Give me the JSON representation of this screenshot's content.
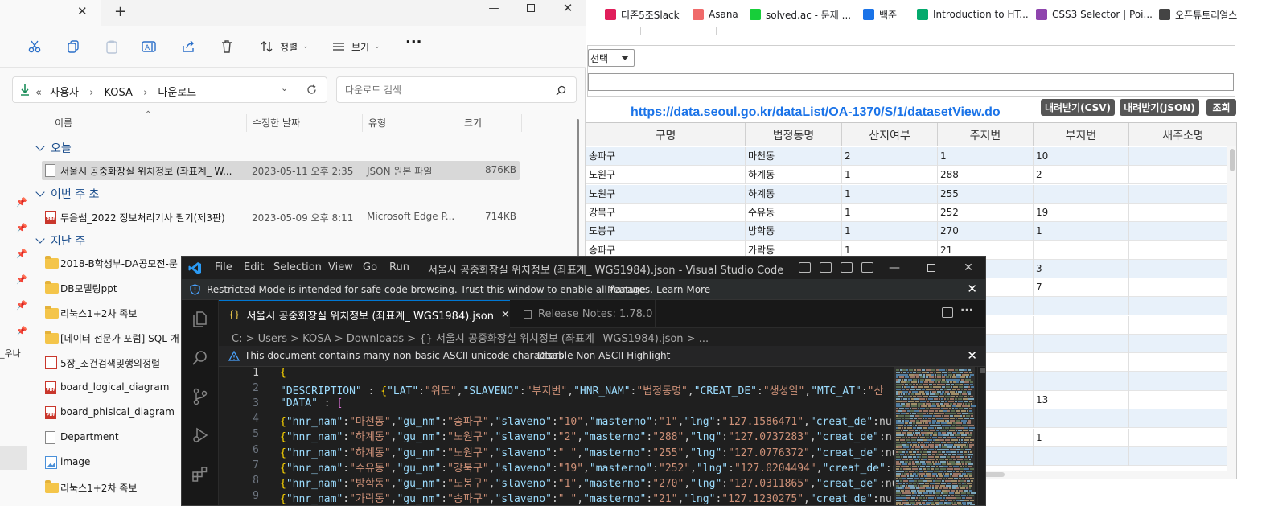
{
  "bookmarks": [
    {
      "label": "더존5조Slack",
      "icon": "slack-icon",
      "color": "#e01e5a"
    },
    {
      "label": "Asana",
      "icon": "asana-icon",
      "color": "#f06a6a"
    },
    {
      "label": "solved.ac - 문제 ...",
      "icon": "solvedac-icon",
      "color": "#17ce3a"
    },
    {
      "label": "백준",
      "icon": "code-icon",
      "color": "#1a73e8"
    },
    {
      "label": "Introduction to HT...",
      "icon": "w3schools-icon",
      "color": "#04aa6d"
    },
    {
      "label": "CSS3 Selector | Poi...",
      "icon": "css-icon",
      "color": "#8e44ad"
    },
    {
      "label": "오픈튜토리얼스",
      "icon": "globe-icon",
      "color": "#444444"
    }
  ],
  "seoul": {
    "select_label": "선택",
    "dataset_url": "https://data.seoul.go.kr/dataList/OA-1370/S/1/datasetView.do",
    "btn_csv": "내려받기(CSV)",
    "btn_json": "내려받기(JSON)",
    "btn_query": "조회",
    "columns": [
      "구명",
      "법정동명",
      "산지여부",
      "주지번",
      "부지번",
      "새주소명"
    ],
    "rows": [
      [
        "송파구",
        "마천동",
        "2",
        "1",
        "10",
        ""
      ],
      [
        "노원구",
        "하계동",
        "1",
        "288",
        "2",
        ""
      ],
      [
        "노원구",
        "하계동",
        "1",
        "255",
        "",
        ""
      ],
      [
        "강북구",
        "수유동",
        "1",
        "252",
        "19",
        ""
      ],
      [
        "도봉구",
        "방학동",
        "1",
        "270",
        "1",
        ""
      ],
      [
        "송파구",
        "가락동",
        "1",
        "21",
        "",
        ""
      ],
      [
        "",
        "",
        "",
        "",
        "3",
        ""
      ],
      [
        "",
        "",
        "",
        "",
        "7",
        ""
      ],
      [
        "",
        "",
        "",
        "",
        "",
        ""
      ],
      [
        "",
        "",
        "",
        "",
        "",
        ""
      ],
      [
        "",
        "",
        "",
        "",
        "",
        ""
      ],
      [
        "",
        "",
        "",
        "",
        "",
        ""
      ],
      [
        "",
        "",
        "",
        "",
        "",
        ""
      ],
      [
        "",
        "",
        "",
        "",
        "13",
        ""
      ],
      [
        "",
        "",
        "",
        "",
        "",
        ""
      ],
      [
        "",
        "",
        "",
        "",
        "1",
        ""
      ],
      [
        "",
        "",
        "",
        "",
        "",
        ""
      ]
    ]
  },
  "explorer": {
    "toolbar": {
      "sort": "정렬",
      "view": "보기"
    },
    "breadcrumb": [
      "사용자",
      "KOSA",
      "다운로드"
    ],
    "search_placeholder": "다운로드 검색",
    "columns": {
      "name": "이름",
      "date": "수정한 날짜",
      "type": "유형",
      "size": "크기"
    },
    "groups": {
      "today": "오늘",
      "this_week": "이번 주 초",
      "last_week": "지난 주"
    },
    "files_today": [
      {
        "name": "서울시 공중화장실 위치정보 (좌표계_ W...",
        "date": "2023-05-11 오후 2:35",
        "type": "JSON 원본 파일",
        "size": "876KB"
      }
    ],
    "files_week": [
      {
        "name": "두음쌤_2022 정보처리기사 필기(제3판)",
        "date": "2023-05-09 오후 8:11",
        "type": "Microsoft Edge P...",
        "size": "714KB"
      }
    ],
    "files_last": [
      {
        "name": "2018-B학생부-DA공모전-문",
        "kind": "folder"
      },
      {
        "name": "DB모델링ppt",
        "kind": "folder"
      },
      {
        "name": "리눅스1+2차 족보",
        "kind": "folder"
      },
      {
        "name": "[데이터 전문가 포럼] SQL 개",
        "kind": "folder"
      },
      {
        "name": "5장_조건검색및행의정렬",
        "kind": "pptx"
      },
      {
        "name": "board_logical_diagram",
        "kind": "pdf"
      },
      {
        "name": "board_phisical_diagram",
        "kind": "pdf"
      },
      {
        "name": "Department",
        "kind": "doc"
      },
      {
        "name": "image",
        "kind": "image"
      },
      {
        "name": "리눅스1+2차 족보",
        "kind": "folder"
      }
    ],
    "left_strip_text": "_우나"
  },
  "vscode": {
    "menu": [
      "File",
      "Edit",
      "Selection",
      "View",
      "Go",
      "Run"
    ],
    "title": "서울시 공중화장실 위치정보 (좌표계_ WGS1984).json - Visual Studio Code",
    "banner_text": "Restricted Mode is intended for safe code browsing. Trust this window to enable all features.",
    "banner_manage": "Manage",
    "banner_learn": "Learn More",
    "tab_active": "서울시 공중화장실 위치정보 (좌표계_ WGS1984).json",
    "tab_inactive": "Release Notes: 1.78.0",
    "breadcrumb": "C: > Users > KOSA > Downloads > {} 서울시 공중화장실 위치정보 (좌표계_ WGS1984).json > ...",
    "warning_text": "This document contains many non-basic ASCII unicode characters",
    "warning_link": "Disable Non ASCII Highlight",
    "code_lines": [
      "{",
      "\"DESCRIPTION\" : {\"LAT\":\"위도\",\"SLAVENO\":\"부지번\",\"HNR_NAM\":\"법정동명\",\"CREAT_DE\":\"생성일\",\"MTC_AT\":\"산",
      "\"DATA\" : [",
      "{\"hnr_nam\":\"마천동\",\"gu_nm\":\"송파구\",\"slaveno\":\"10\",\"masterno\":\"1\",\"lng\":\"127.1586471\",\"creat_de\":nu",
      "{\"hnr_nam\":\"하계동\",\"gu_nm\":\"노원구\",\"slaveno\":\"2\",\"masterno\":\"288\",\"lng\":\"127.0737283\",\"creat_de\":n",
      "{\"hnr_nam\":\"하계동\",\"gu_nm\":\"노원구\",\"slaveno\":\" \",\"masterno\":\"255\",\"lng\":\"127.0776372\",\"creat_de\":nu",
      "{\"hnr_nam\":\"수유동\",\"gu_nm\":\"강북구\",\"slaveno\":\"19\",\"masterno\":\"252\",\"lng\":\"127.0204494\",\"creat_de\":r",
      "{\"hnr_nam\":\"방학동\",\"gu_nm\":\"도봉구\",\"slaveno\":\"1\",\"masterno\":\"270\",\"lng\":\"127.0311865\",\"creat_de\":nu",
      "{\"hnr_nam\":\"가락동\",\"gu_nm\":\"송파구\",\"slaveno\":\" \",\"masterno\":\"21\",\"lng\":\"127.1230275\",\"creat_de\":nu"
    ]
  }
}
